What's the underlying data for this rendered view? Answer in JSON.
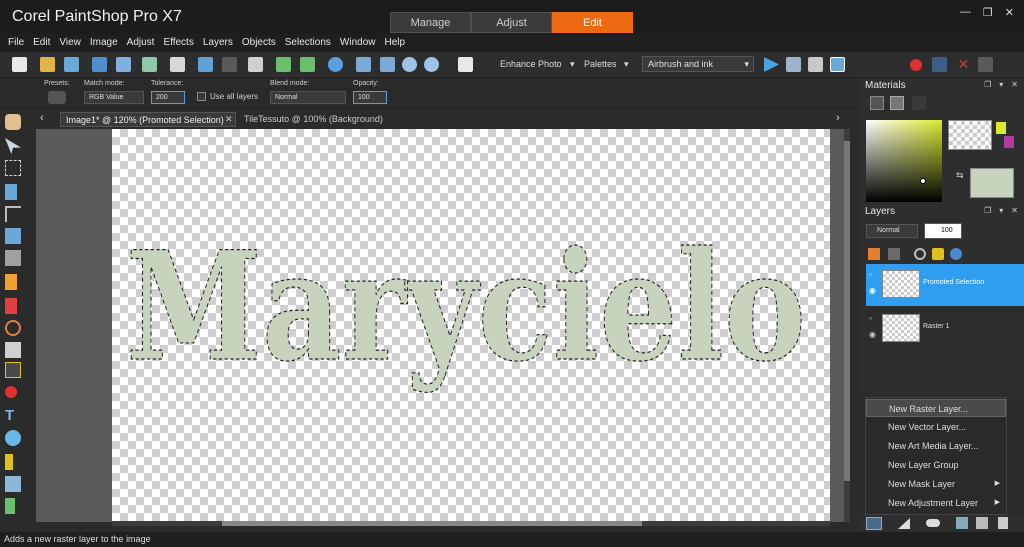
{
  "app": {
    "title": "Corel PaintShop Pro X7"
  },
  "workspace_tabs": [
    {
      "label": "Manage"
    },
    {
      "label": "Adjust"
    },
    {
      "label": "Edit"
    }
  ],
  "window_controls": {
    "minimize": "—",
    "restore": "❐",
    "close": "✕"
  },
  "menu": [
    "File",
    "Edit",
    "View",
    "Image",
    "Adjust",
    "Effects",
    "Layers",
    "Objects",
    "Selections",
    "Window",
    "Help"
  ],
  "toolbar": {
    "enhance_photo": "Enhance Photo",
    "palettes": "Palettes",
    "workspace_select": "Airbrush and ink"
  },
  "options": {
    "presets_label": "Presets:",
    "match_mode_label": "Match mode:",
    "match_mode_value": "RGB Value",
    "tolerance_label": "Tolerance:",
    "tolerance_value": "200",
    "use_all_layers": "Use all layers",
    "blend_mode_label": "Blend mode:",
    "blend_mode_value": "Normal",
    "opacity_label": "Opacity:",
    "opacity_value": "100"
  },
  "documents": {
    "tab1": "Image1* @ 120% (Promoted Selection)",
    "tab2": "TileTessuto @ 100% (Background)"
  },
  "canvas": {
    "text": "Marycielo",
    "fill_color": "#c8d3bd"
  },
  "status": "Adds a new raster layer to the image",
  "materials": {
    "title": "Materials",
    "foreground": "#c8d3bd",
    "accent": "#d9ea2c"
  },
  "layers_panel": {
    "title": "Layers",
    "blend_value": "Normal",
    "opacity_value": "100",
    "layers": [
      {
        "name": "Promoted Selection"
      },
      {
        "name": "Raster 1"
      }
    ]
  },
  "context_menu": [
    {
      "label": "New Raster Layer..."
    },
    {
      "label": "New Vector Layer..."
    },
    {
      "label": "New Art Media Layer..."
    },
    {
      "label": "New Layer Group"
    },
    {
      "label": "New Mask Layer"
    },
    {
      "label": "New Adjustment Layer"
    }
  ]
}
